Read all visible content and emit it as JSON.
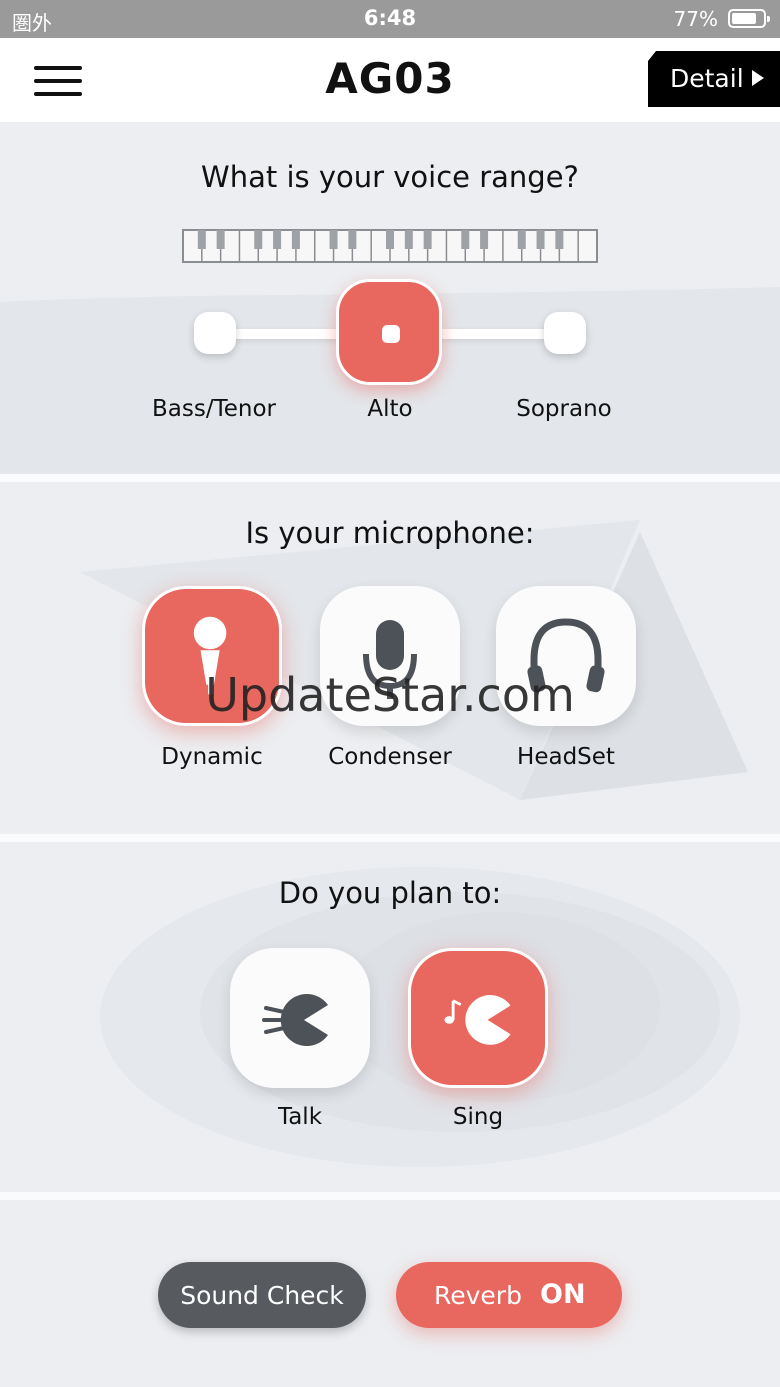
{
  "status_bar": {
    "carrier": "圏外",
    "time": "6:48",
    "battery": "77%"
  },
  "header": {
    "title": "AG03",
    "detail_label": "Detail"
  },
  "voice_range": {
    "question": "What is your voice range?",
    "options": [
      "Bass/Tenor",
      "Alto",
      "Soprano"
    ],
    "selected": "Alto"
  },
  "microphone": {
    "question": "Is your microphone:",
    "options": [
      "Dynamic",
      "Condenser",
      "HeadSet"
    ],
    "selected": "Dynamic"
  },
  "plan": {
    "question": "Do you plan to:",
    "options": [
      "Talk",
      "Sing"
    ],
    "selected": "Sing"
  },
  "footer": {
    "sound_check_label": "Sound Check",
    "reverb_label": "Reverb",
    "reverb_state": "ON"
  },
  "watermark": "UpdateStar.com",
  "colors": {
    "accent": "#e8675f",
    "dark_button": "#575b60",
    "header_bg": "#ffffff",
    "status_bg": "#9a9a9a"
  }
}
